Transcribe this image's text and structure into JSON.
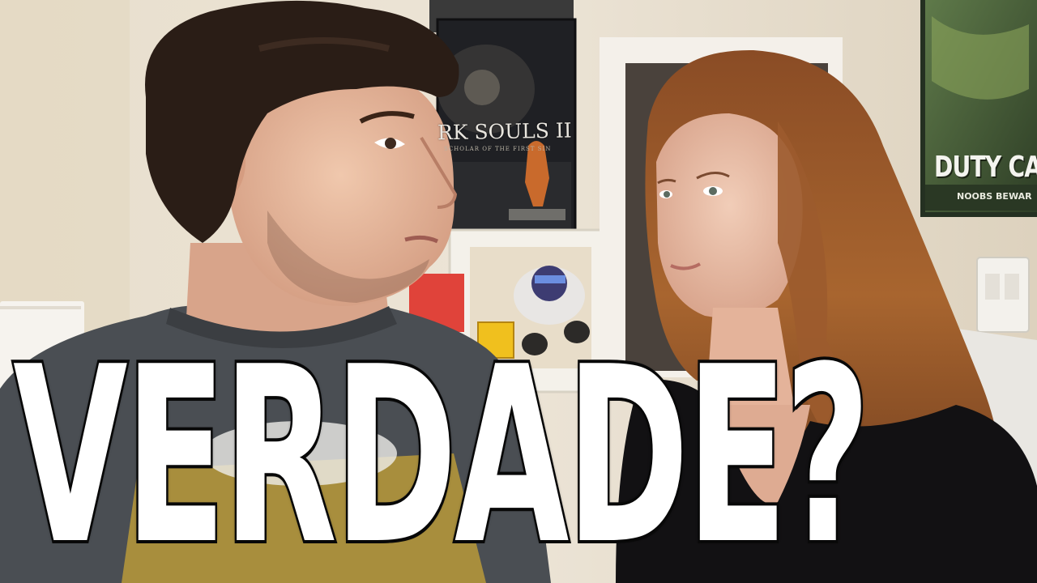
{
  "caption": "VERDADE?",
  "posters": {
    "left": {
      "title": "RK SOULS II",
      "subtitle": "SCHOLAR OF THE FIRST SIN"
    },
    "right": {
      "title": "DUTY CAL",
      "subtitle": "NOOBS BEWAR"
    }
  },
  "palette": {
    "wall": "#e6dccb",
    "caption_fill": "#ffffff",
    "caption_outline": "#0a0a0a",
    "man_shirt": "#4a4e53",
    "woman_hair": "#9a5a2e"
  }
}
